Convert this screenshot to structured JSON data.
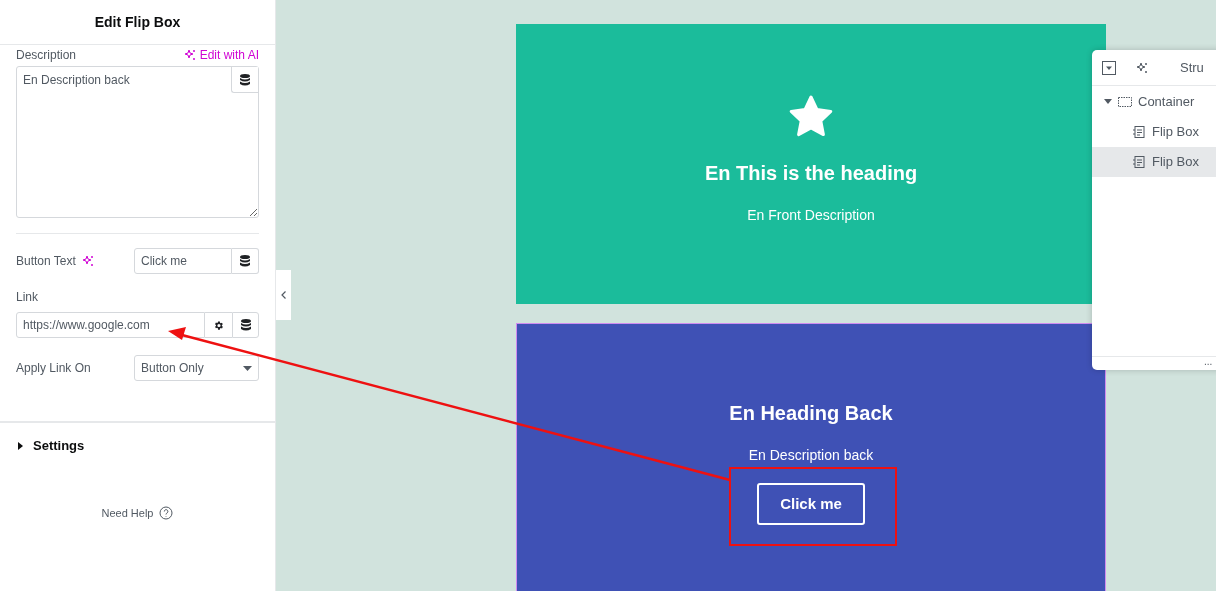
{
  "panel": {
    "title": "Edit Flip Box",
    "description": {
      "label": "Description",
      "ai_link": "Edit with AI",
      "value": "En Description back"
    },
    "button_text": {
      "label": "Button Text",
      "value": "Click me"
    },
    "link": {
      "label": "Link",
      "value": "https://www.google.com"
    },
    "apply_link_on": {
      "label": "Apply Link On",
      "value": "Button Only"
    },
    "sections": [
      {
        "label": "Settings",
        "expanded": false
      }
    ],
    "help": "Need Help"
  },
  "canvas": {
    "front": {
      "heading": "En This is the heading",
      "description": "En Front Description"
    },
    "back": {
      "heading": "En Heading Back",
      "description": "En Description back",
      "button": "Click me"
    }
  },
  "structure": {
    "title": "Stru",
    "more": "...",
    "tree": [
      {
        "label": "Container",
        "kind": "container",
        "expanded": true,
        "selected": false,
        "children": [
          {
            "label": "Flip Box",
            "kind": "widget",
            "selected": false
          },
          {
            "label": "Flip Box",
            "kind": "widget",
            "selected": true
          }
        ]
      }
    ]
  }
}
